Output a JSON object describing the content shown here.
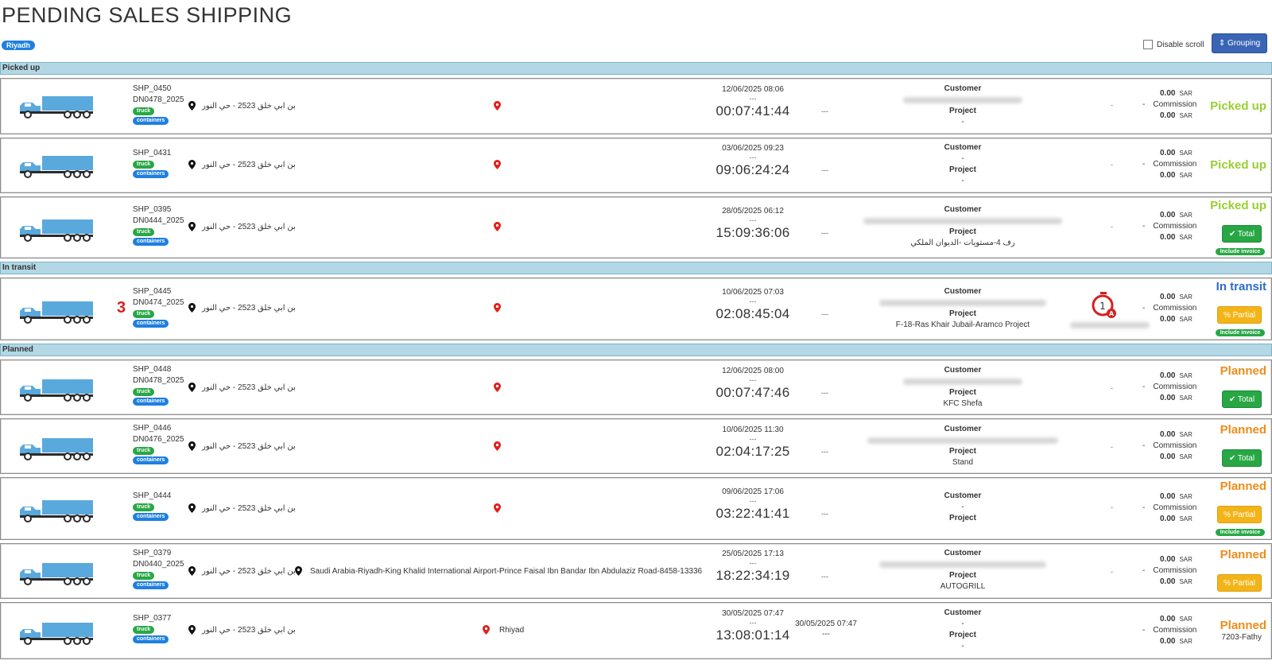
{
  "page": {
    "title": "PENDING SALES SHIPPING"
  },
  "header": {
    "branch": "Riyadh",
    "disable_scroll_label": "Disable scroll",
    "grouping_label": "⇕ Grouping"
  },
  "sections": {
    "picked_up": "Picked up",
    "in_transit": "In transit",
    "planned": "Planned"
  },
  "labels": {
    "truck": "truck",
    "containers": "containers",
    "customer": "Customer",
    "project": "Project",
    "commission": "Commission",
    "currency": "SAR",
    "amount": "0.00",
    "dash": "-",
    "dashes": "---",
    "total_btn": "✔ Total",
    "partial_btn": "% Partial",
    "include_invoice": "Include invoice"
  },
  "colors": {
    "picked_up": "#9acd32",
    "in_transit": "#2d6bc8",
    "planned": "#ef8c1a",
    "section_bg": "#b3d7e5",
    "truck": "#5aa9dd"
  },
  "icons": {
    "truck": "truck-icon",
    "origin_pin": "map-pin-icon",
    "dest_pin": "red-map-pin-icon",
    "timer": "stopwatch-icon"
  },
  "shipments": [
    {
      "ship_no": "SHP_0450",
      "dn_no": "DN0478_2025",
      "origin": "بن ابي خلق 2523 - حي النور",
      "start_date": "12/06/2025 08:06",
      "elapsed": "00:07:41:44",
      "project": "-",
      "status": "Picked up"
    },
    {
      "ship_no": "SHP_0431",
      "dn_no": "",
      "origin": "بن ابي خلق 2523 - حي النور",
      "start_date": "03/06/2025 09:23",
      "elapsed": "09:06:24:24",
      "project": "-",
      "status": "Picked up"
    },
    {
      "ship_no": "SHP_0395",
      "dn_no": "DN0444_2025",
      "origin": "بن ابي خلق 2523 - حي النور",
      "start_date": "28/05/2025 06:12",
      "elapsed": "15:09:36:06",
      "project": "رف 4-مستويات -الديوان الملكي",
      "status": "Picked up"
    },
    {
      "ship_no": "SHP_0445",
      "dn_no": "DN0474_2025",
      "marker": "3",
      "origin": "بن ابي خلق 2523 - حي النور",
      "start_date": "10/06/2025 07:03",
      "elapsed": "02:08:45:04",
      "project": "F-18-Ras Khair Jubail-Aramco Project",
      "status": "In transit"
    },
    {
      "ship_no": "SHP_0448",
      "dn_no": "DN0478_2025",
      "origin": "بن ابي خلق 2523 - حي النور",
      "start_date": "12/06/2025 08:00",
      "elapsed": "00:07:47:46",
      "project": "KFC Shefa",
      "status": "Planned"
    },
    {
      "ship_no": "SHP_0446",
      "dn_no": "DN0476_2025",
      "origin": "بن ابي خلق 2523 - حي النور",
      "start_date": "10/06/2025 11:30",
      "elapsed": "02:04:17:25",
      "project": "Stand",
      "status": "Planned"
    },
    {
      "ship_no": "SHP_0444",
      "dn_no": "",
      "origin": "بن ابي خلق 2523 - حي النور",
      "start_date": "09/06/2025 17:06",
      "elapsed": "03:22:41:41",
      "project": "",
      "status": "Planned"
    },
    {
      "ship_no": "SHP_0379",
      "dn_no": "DN0440_2025",
      "origin": "بن ابي خلق 2523 - حي النور",
      "destination": "Saudi Arabia-Riyadh-King Khalid International Airport-Prince Faisal Ibn Bandar Ibn Abdulaziz Road-8458-13336",
      "start_date": "25/05/2025 17:13",
      "elapsed": "18:22:34:19",
      "project": "AUTOGRILL",
      "status": "Planned"
    },
    {
      "ship_no": "SHP_0377",
      "dn_no": "",
      "origin": "بن ابي خلق 2523 - حي النور",
      "destination": "Rhiyad",
      "start_date": "30/05/2025 07:47",
      "second_date": "30/05/2025 07:47",
      "elapsed": "13:08:01:14",
      "project": "-",
      "status": "Planned",
      "note": "7203-Fathy"
    }
  ]
}
